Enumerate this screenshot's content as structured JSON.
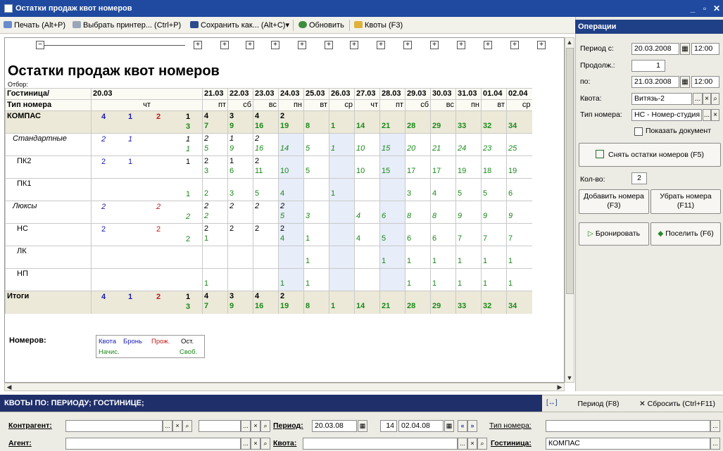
{
  "window": {
    "title": "Остатки продаж квот номеров",
    "min": "_",
    "restore": "▫",
    "close": "✕"
  },
  "toolbar": {
    "print": "Печать (Alt+P)",
    "printer": "Выбрать принтер... (Ctrl+P)",
    "save_as": "Сохранить как... (Alt+C)",
    "refresh": "Обновить",
    "quotas": "Квоты (F3)"
  },
  "report": {
    "title": "Остатки продаж квот номеров",
    "filter_label": "Отбор:",
    "col_head_left_1": "Гостиница/",
    "col_head_left_2": "Тип номера",
    "dates": [
      "20.03",
      "21.03",
      "22.03",
      "23.03",
      "24.03",
      "25.03",
      "26.03",
      "27.03",
      "28.03",
      "29.03",
      "30.03",
      "31.03",
      "01.04",
      "02.04"
    ],
    "days": [
      "чт",
      "пт",
      "сб",
      "вс",
      "пн",
      "вт",
      "ср",
      "чт",
      "пт",
      "сб",
      "вс",
      "пн",
      "вт",
      "ср"
    ],
    "first_day_parts": {
      "quota": "4",
      "book": "1",
      "pro": "2",
      "free_top": "1",
      "free_bottom": "3"
    },
    "rows": [
      {
        "name": "КОМПАС",
        "style": "bold",
        "d0": [
          "4",
          "1",
          "2",
          "1",
          "3"
        ],
        "vals": [
          [
            "4",
            "7"
          ],
          [
            "3",
            "9"
          ],
          [
            "4",
            "16"
          ],
          [
            "2",
            "19"
          ],
          [
            "",
            "8"
          ],
          [
            "",
            "1"
          ],
          [
            "",
            "14"
          ],
          [
            "",
            "21"
          ],
          [
            "",
            "28"
          ],
          [
            "",
            "29"
          ],
          [
            "",
            "33"
          ],
          [
            "",
            "32"
          ],
          [
            "",
            "34"
          ]
        ]
      },
      {
        "name": "Стандартные",
        "style": "ital",
        "d0": [
          "2",
          "1",
          "",
          "1",
          "1"
        ],
        "vals": [
          [
            "2",
            "5"
          ],
          [
            "1",
            "9"
          ],
          [
            "2",
            "16"
          ],
          [
            "",
            "14"
          ],
          [
            "",
            "5"
          ],
          [
            "",
            "1"
          ],
          [
            "",
            "10"
          ],
          [
            "",
            "15"
          ],
          [
            "",
            "20"
          ],
          [
            "",
            "21"
          ],
          [
            "",
            "24"
          ],
          [
            "",
            "23"
          ],
          [
            "",
            "25"
          ]
        ]
      },
      {
        "name": "ПК2",
        "style": "",
        "d0": [
          "2",
          "1",
          "",
          "1",
          ""
        ],
        "vals": [
          [
            "2",
            "3"
          ],
          [
            "1",
            "6"
          ],
          [
            "2",
            "11"
          ],
          [
            "",
            "10"
          ],
          [
            "",
            "5"
          ],
          [
            "",
            ""
          ],
          [
            "",
            "10"
          ],
          [
            "",
            "15"
          ],
          [
            "",
            "17"
          ],
          [
            "",
            "17"
          ],
          [
            "",
            "19"
          ],
          [
            "",
            "18"
          ],
          [
            "",
            "19"
          ]
        ]
      },
      {
        "name": "ПК1",
        "style": "",
        "d0": [
          "",
          "",
          "",
          "",
          "1"
        ],
        "vals": [
          [
            "",
            "2"
          ],
          [
            "",
            "3"
          ],
          [
            "",
            "5"
          ],
          [
            "",
            "4"
          ],
          [
            "",
            ""
          ],
          [
            "",
            "1"
          ],
          [
            "",
            ""
          ],
          [
            "",
            ""
          ],
          [
            "",
            "3"
          ],
          [
            "",
            "4"
          ],
          [
            "",
            "5"
          ],
          [
            "",
            "5"
          ],
          [
            "",
            "6"
          ]
        ]
      },
      {
        "name": "Люксы",
        "style": "ital",
        "d0": [
          "2",
          "",
          "2",
          "",
          "2"
        ],
        "vals": [
          [
            "2",
            "2"
          ],
          [
            "2",
            ""
          ],
          [
            "2",
            ""
          ],
          [
            "2",
            "5"
          ],
          [
            "",
            "3"
          ],
          [
            "",
            ""
          ],
          [
            "",
            "4"
          ],
          [
            "",
            "6"
          ],
          [
            "",
            "8"
          ],
          [
            "",
            "8"
          ],
          [
            "",
            "9"
          ],
          [
            "",
            "9"
          ],
          [
            "",
            "9"
          ]
        ]
      },
      {
        "name": "НС",
        "style": "",
        "d0": [
          "2",
          "",
          "2",
          "",
          "2"
        ],
        "vals": [
          [
            "2",
            "1"
          ],
          [
            "2",
            ""
          ],
          [
            "2",
            ""
          ],
          [
            "2",
            "4"
          ],
          [
            "",
            "1"
          ],
          [
            "",
            ""
          ],
          [
            "",
            "4"
          ],
          [
            "",
            "5"
          ],
          [
            "",
            "6"
          ],
          [
            "",
            "6"
          ],
          [
            "",
            "7"
          ],
          [
            "",
            "7"
          ],
          [
            "",
            "7"
          ]
        ]
      },
      {
        "name": "ЛК",
        "style": "",
        "d0": [
          "",
          "",
          "",
          "",
          ""
        ],
        "vals": [
          [
            "",
            ""
          ],
          [
            "",
            ""
          ],
          [
            "",
            ""
          ],
          [
            "",
            ""
          ],
          [
            "",
            "1"
          ],
          [
            "",
            ""
          ],
          [
            "",
            ""
          ],
          [
            "",
            "1"
          ],
          [
            "",
            "1"
          ],
          [
            "",
            "1"
          ],
          [
            "",
            "1"
          ],
          [
            "",
            "1"
          ],
          [
            "",
            "1"
          ]
        ]
      },
      {
        "name": "НП",
        "style": "",
        "d0": [
          "",
          "",
          "",
          "",
          ""
        ],
        "vals": [
          [
            "",
            "1"
          ],
          [
            "",
            ""
          ],
          [
            "",
            ""
          ],
          [
            "",
            "1"
          ],
          [
            "",
            "1"
          ],
          [
            "",
            ""
          ],
          [
            "",
            ""
          ],
          [
            "",
            ""
          ],
          [
            "",
            "1"
          ],
          [
            "",
            "1"
          ],
          [
            "",
            "1"
          ],
          [
            "",
            "1"
          ],
          [
            "",
            "1"
          ]
        ]
      },
      {
        "name": "Итоги",
        "style": "bold",
        "d0": [
          "4",
          "1",
          "2",
          "1",
          "3"
        ],
        "vals": [
          [
            "4",
            "7"
          ],
          [
            "3",
            "9"
          ],
          [
            "4",
            "16"
          ],
          [
            "2",
            "19"
          ],
          [
            "",
            "8"
          ],
          [
            "",
            "1"
          ],
          [
            "",
            "14"
          ],
          [
            "",
            "21"
          ],
          [
            "",
            "28"
          ],
          [
            "",
            "29"
          ],
          [
            "",
            "33"
          ],
          [
            "",
            "32"
          ],
          [
            "",
            "34"
          ]
        ]
      }
    ],
    "legend_label": "Номеров:",
    "legend": {
      "quota": "Квота",
      "book": "Бронь",
      "pro": "Прож.",
      "rest": "Ост.",
      "charged": "Начис.",
      "free": "Своб."
    }
  },
  "ops": {
    "title": "Операции",
    "period_from_label": "Период с:",
    "period_from_date": "20.03.2008",
    "period_from_time": "12:00",
    "duration_label": "Продолж.:",
    "duration_value": "1",
    "to_label": "по:",
    "to_date": "21.03.2008",
    "to_time": "12:00",
    "quota_label": "Квота:",
    "quota_value": "Витязь-2",
    "room_type_label": "Тип номера:",
    "room_type_value": "НС - Номер-студия",
    "show_doc": "Показать документ",
    "take_rest": "Снять остатки номеров (F5)",
    "qty_label": "Кол-во:",
    "qty_value": "2",
    "add_rooms": "Добавить номера (F3)",
    "remove_rooms": "Убрать номера (F11)",
    "book": "Бронировать",
    "settle": "Поселить (F6)"
  },
  "filters": {
    "header": "КВОТЫ ПО: ПЕРИОДУ; ГОСТИНИЦЕ;",
    "period_btn": "Период (F8)",
    "reset_btn": "Сбросить (Ctrl+F11)",
    "counterparty_label": "Контрагент:",
    "agent_label": "Агент:",
    "period_label": "Период:",
    "period_from": "20.03.08",
    "period_days": "14",
    "period_to": "02.04.08",
    "quota_label": "Квота:",
    "room_type_label": "Тип номера:",
    "hotel_label": "Гостиница:",
    "hotel_value": "КОМПАС"
  }
}
